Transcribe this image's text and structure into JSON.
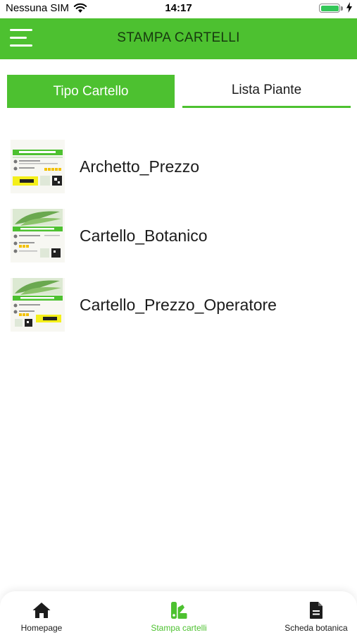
{
  "status_bar": {
    "carrier": "Nessuna SIM",
    "time": "14:17",
    "battery_level": 1.0,
    "icons": [
      "wifi-icon",
      "battery-icon",
      "charging-icon"
    ]
  },
  "header": {
    "title": "STAMPA CARTELLI",
    "menu_icon": "hamburger-menu-icon"
  },
  "tabs": [
    {
      "label": "Tipo Cartello",
      "active": true
    },
    {
      "label": "Lista Piante",
      "active": false
    }
  ],
  "list": {
    "items": [
      {
        "label": "Archetto_Prezzo",
        "thumbnail": "price-tag-thumbnail"
      },
      {
        "label": "Cartello_Botanico",
        "thumbnail": "botanical-card-thumbnail"
      },
      {
        "label": "Cartello_Prezzo_Operatore",
        "thumbnail": "operator-price-card-thumbnail"
      }
    ]
  },
  "bottom_nav": {
    "items": [
      {
        "label": "Homepage",
        "icon": "home-icon",
        "active": false
      },
      {
        "label": "Stampa cartelli",
        "icon": "print-labels-icon",
        "active": true
      },
      {
        "label": "Scheda botanica",
        "icon": "document-icon",
        "active": false
      }
    ]
  },
  "colors": {
    "accent": "#4dc130",
    "header_title": "#17390f",
    "text": "#1c1c1c",
    "background": "#ffffff"
  }
}
